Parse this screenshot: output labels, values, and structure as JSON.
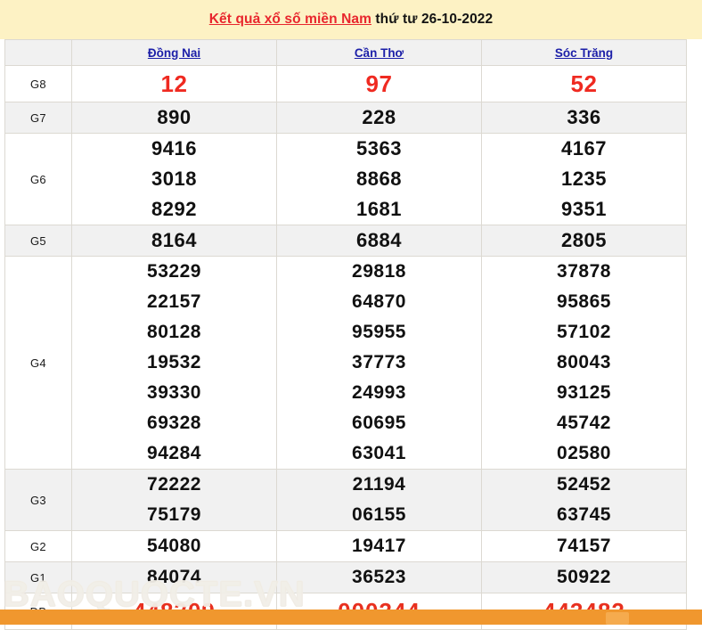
{
  "header": {
    "title_highlight": "Kết quả xổ số miền Nam",
    "title_rest": " thứ tư 26-10-2022",
    "bg_color": "#fdf2c4",
    "highlight_color": "#e8262d"
  },
  "table": {
    "corner_label": "",
    "provinces": [
      "Đồng Nai",
      "Cần Thơ",
      "Sóc Trăng"
    ],
    "province_link_color": "#1c1fa8",
    "rows": [
      {
        "label": "G8",
        "style": "red",
        "shade": false,
        "values": {
          "dong_nai": [
            "12"
          ],
          "can_tho": [
            "97"
          ],
          "soc_trang": [
            "52"
          ]
        }
      },
      {
        "label": "G7",
        "style": "black",
        "shade": true,
        "values": {
          "dong_nai": [
            "890"
          ],
          "can_tho": [
            "228"
          ],
          "soc_trang": [
            "336"
          ]
        }
      },
      {
        "label": "G6",
        "style": "black",
        "shade": false,
        "values": {
          "dong_nai": [
            "9416",
            "3018",
            "8292"
          ],
          "can_tho": [
            "5363",
            "8868",
            "1681"
          ],
          "soc_trang": [
            "4167",
            "1235",
            "9351"
          ]
        }
      },
      {
        "label": "G5",
        "style": "black",
        "shade": true,
        "values": {
          "dong_nai": [
            "8164"
          ],
          "can_tho": [
            "6884"
          ],
          "soc_trang": [
            "2805"
          ]
        }
      },
      {
        "label": "G4",
        "style": "black",
        "shade": false,
        "values": {
          "dong_nai": [
            "53229",
            "22157",
            "80128",
            "19532",
            "39330",
            "69328",
            "94284"
          ],
          "can_tho": [
            "29818",
            "64870",
            "95955",
            "37773",
            "24993",
            "60695",
            "63041"
          ],
          "soc_trang": [
            "37878",
            "95865",
            "57102",
            "80043",
            "93125",
            "45742",
            "02580"
          ]
        }
      },
      {
        "label": "G3",
        "style": "black",
        "shade": true,
        "values": {
          "dong_nai": [
            "72222",
            "75179"
          ],
          "can_tho": [
            "21194",
            "06155"
          ],
          "soc_trang": [
            "52452",
            "63745"
          ]
        }
      },
      {
        "label": "G2",
        "style": "black",
        "shade": false,
        "values": {
          "dong_nai": [
            "54080"
          ],
          "can_tho": [
            "19417"
          ],
          "soc_trang": [
            "74157"
          ]
        }
      },
      {
        "label": "G1",
        "style": "black",
        "shade": true,
        "values": {
          "dong_nai": [
            "84074"
          ],
          "can_tho": [
            "36523"
          ],
          "soc_trang": [
            "50922"
          ]
        }
      },
      {
        "label": "ĐB",
        "style": "db",
        "shade": false,
        "values": {
          "dong_nai": [
            "448309"
          ],
          "can_tho": [
            "000344"
          ],
          "soc_trang": [
            "443482"
          ]
        }
      }
    ]
  },
  "watermark": {
    "text": "BAOQUOCTE.VN"
  },
  "footer": {
    "bar_color": "#f0972e"
  }
}
